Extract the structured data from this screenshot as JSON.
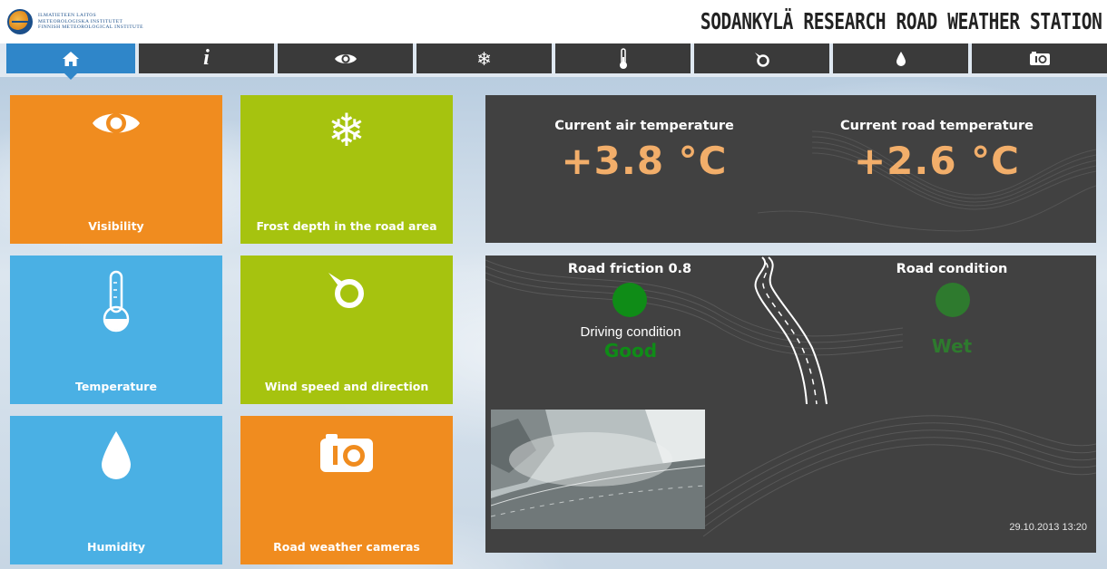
{
  "header": {
    "logo_lines": [
      "ILMATIETEEN LAITOS",
      "METEOROLOGISKA INSTITUTET",
      "FINNISH METEOROLOGICAL INSTITUTE"
    ],
    "title": "Sodankylä Research Road Weather Station"
  },
  "nav": {
    "items": [
      {
        "icon": "home-icon",
        "glyph": "⌂"
      },
      {
        "icon": "info-icon",
        "glyph": "i"
      },
      {
        "icon": "eye-icon",
        "glyph": ""
      },
      {
        "icon": "snowflake-icon",
        "glyph": "❄"
      },
      {
        "icon": "thermometer-icon",
        "glyph": ""
      },
      {
        "icon": "wind-icon",
        "glyph": ""
      },
      {
        "icon": "drop-icon",
        "glyph": ""
      },
      {
        "icon": "camera-icon",
        "glyph": ""
      }
    ]
  },
  "tiles": {
    "visibility": "Visibility",
    "frost": "Frost depth in the road area",
    "temperature": "Temperature",
    "wind": "Wind speed and direction",
    "humidity": "Humidity",
    "cameras": "Road weather cameras"
  },
  "temperatures": {
    "air_label": "Current air temperature",
    "air_value": "+3.8 °C",
    "road_label": "Current road temperature",
    "road_value": "+2.6 °C"
  },
  "road": {
    "friction_label": "Road friction 0.8",
    "driving_label": "Driving condition",
    "driving_value": "Good",
    "condition_label": "Road condition",
    "condition_value": "Wet",
    "timestamp": "29.10.2013 13:20"
  },
  "colors": {
    "orange": "#f08c1f",
    "green": "#a6c30f",
    "blue": "#4ab0e4",
    "panel": "#414141",
    "temp_value": "#f2ae6a",
    "status_good": "#0f8c17",
    "status_wet": "#2e7a2e",
    "nav_active": "#2f86c9"
  }
}
